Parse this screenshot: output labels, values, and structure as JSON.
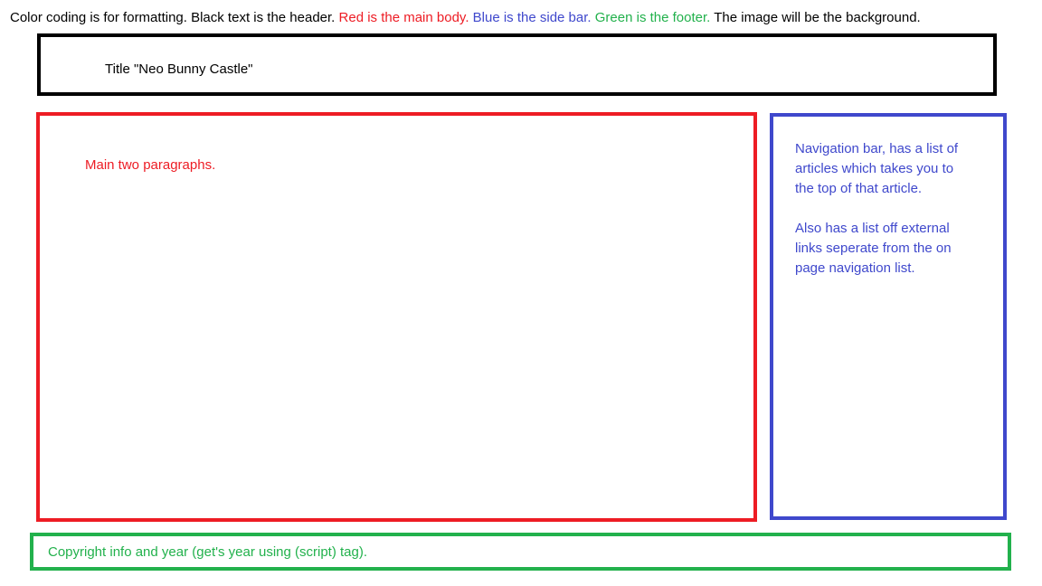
{
  "legend": {
    "black_text": "Color coding is for formatting. Black text is the header. ",
    "red_text": "Red is the main body. ",
    "blue_text": "Blue is the side bar. ",
    "green_text": "Green is the footer. ",
    "end_text": "The image will be the background."
  },
  "header_box": {
    "label": "Title \"Neo Bunny Castle\"",
    "color": "#000000"
  },
  "main_box": {
    "label": "Main two paragraphs.",
    "color": "#ed1c24"
  },
  "sidebar_box": {
    "paragraph_1": "Navigation bar, has a list of articles which takes you to the top of that article.",
    "paragraph_2": "Also has a list off external links seperate from the on page navigation list.",
    "color": "#3f48cc"
  },
  "footer_box": {
    "label": "Copyright info and year (get's year using (script) tag).",
    "color": "#22b14c"
  }
}
